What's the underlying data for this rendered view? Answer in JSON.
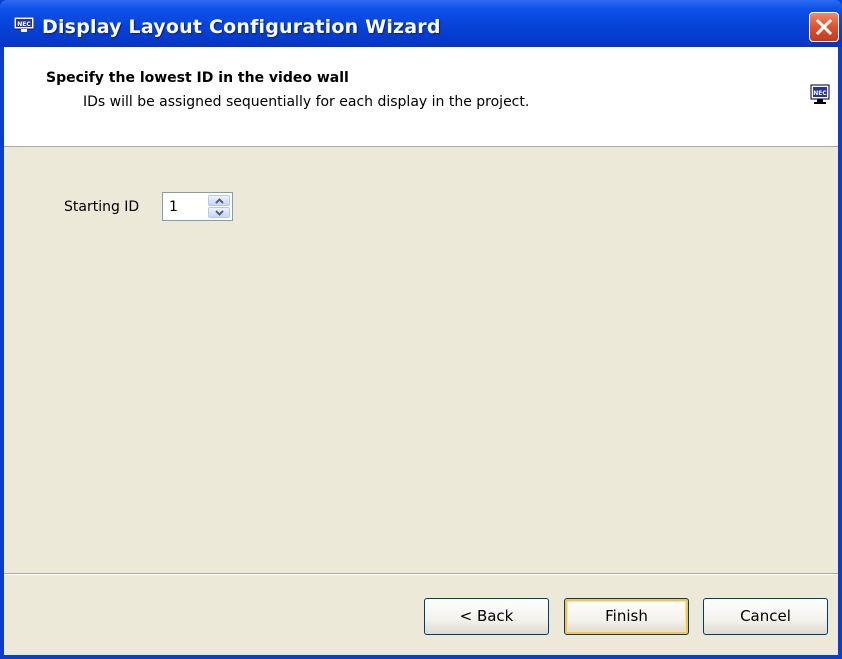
{
  "window": {
    "title": "Display Layout Configuration Wizard",
    "close_icon": "close-icon",
    "app_icon": "nec-monitor-icon"
  },
  "header": {
    "title": "Specify the lowest ID in the video wall",
    "subtitle": "IDs will be assigned sequentially for each display in the project.",
    "icon": "nec-monitor-icon"
  },
  "form": {
    "starting_id_label": "Starting ID",
    "starting_id_value": "1"
  },
  "buttons": {
    "back": "< Back",
    "finish": "Finish",
    "cancel": "Cancel"
  },
  "colors": {
    "titlebar": "#0541d6",
    "client_bg": "#ece9d8",
    "close_button": "#e0502c",
    "default_button_highlight": "#f5c256"
  }
}
